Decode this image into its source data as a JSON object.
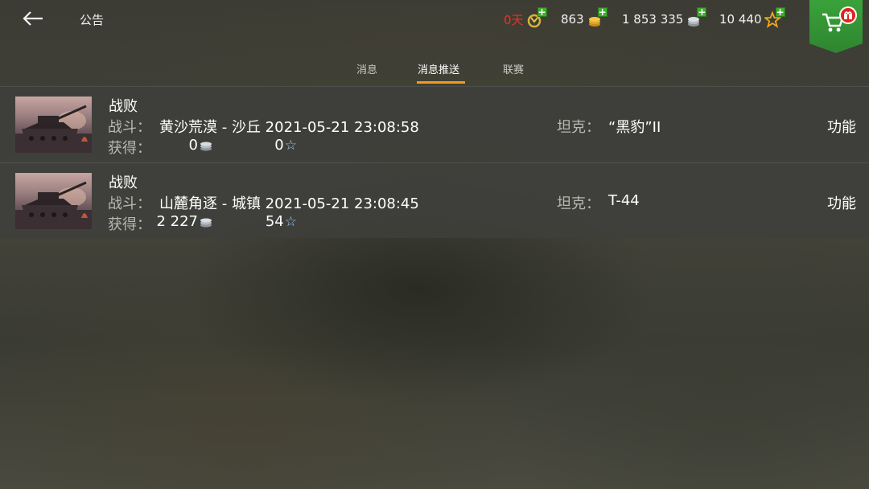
{
  "header": {
    "back_icon": "arrow-left-icon",
    "title": "公告",
    "resources": {
      "premium_days": "0天",
      "gold": "863",
      "credits": "1 853 335",
      "free_xp": "10 440"
    },
    "shop_icon": "shopping-cart-icon",
    "gift_icon": "gift-icon"
  },
  "tabs": [
    {
      "label": "消息",
      "active": false
    },
    {
      "label": "消息推送",
      "active": true
    },
    {
      "label": "联赛",
      "active": false
    }
  ],
  "colors": {
    "active_tab_underline": "#f39a1c",
    "premium_days": "#ff2a1c",
    "shop_green": "#3aa23a"
  },
  "battle_labels": {
    "battle": "战斗：",
    "reward": "获得：",
    "tank": "坦克：",
    "function": "功能"
  },
  "messages": [
    {
      "result": "战败",
      "battle": "黄沙荒漠 - 沙丘 2021-05-21 23:08:58",
      "tank": "“黑豹”II",
      "credits": "0",
      "xp": "0"
    },
    {
      "result": "战败",
      "battle": "山麓角逐 - 城镇 2021-05-21 23:08:45",
      "tank": "T-44",
      "credits": "2 227",
      "xp": "54"
    }
  ]
}
